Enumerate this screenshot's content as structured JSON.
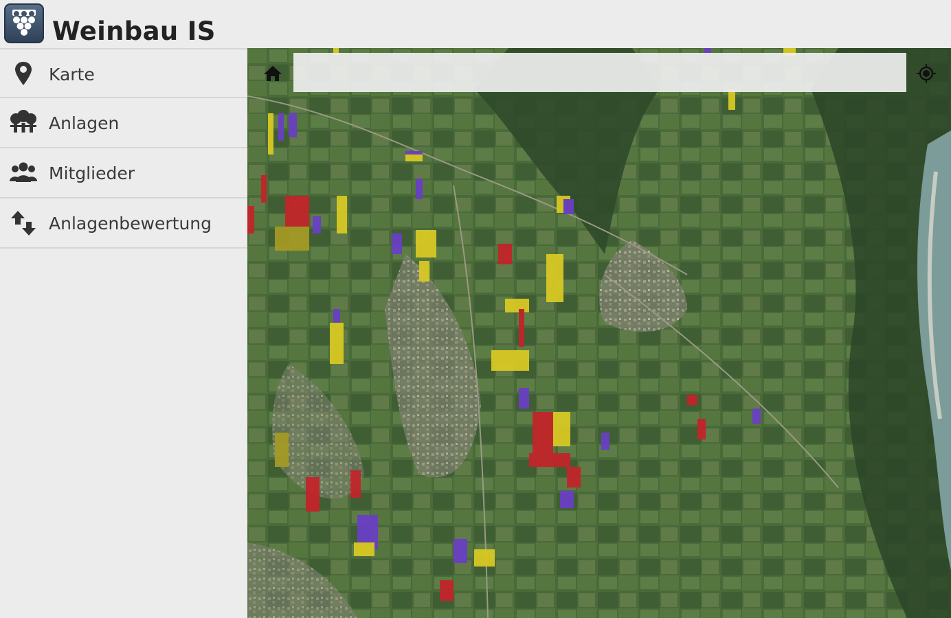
{
  "app": {
    "title": "Weinbau IS",
    "logo_icon": "grapes-logo-icon"
  },
  "sidebar": {
    "items": [
      {
        "label": "Karte",
        "icon": "map-pin-icon"
      },
      {
        "label": "Anlagen",
        "icon": "grape-vines-icon"
      },
      {
        "label": "Mitglieder",
        "icon": "members-icon"
      },
      {
        "label": "Anlagenbewertung",
        "icon": "rating-arrows-icon"
      }
    ]
  },
  "map": {
    "search": {
      "value": "",
      "placeholder": ""
    },
    "home_icon": "home-icon",
    "locate_icon": "locate-icon",
    "parcel_colors": {
      "yellow": "#d8c824",
      "red": "#c2252a",
      "purple": "#6a3fc4"
    }
  }
}
